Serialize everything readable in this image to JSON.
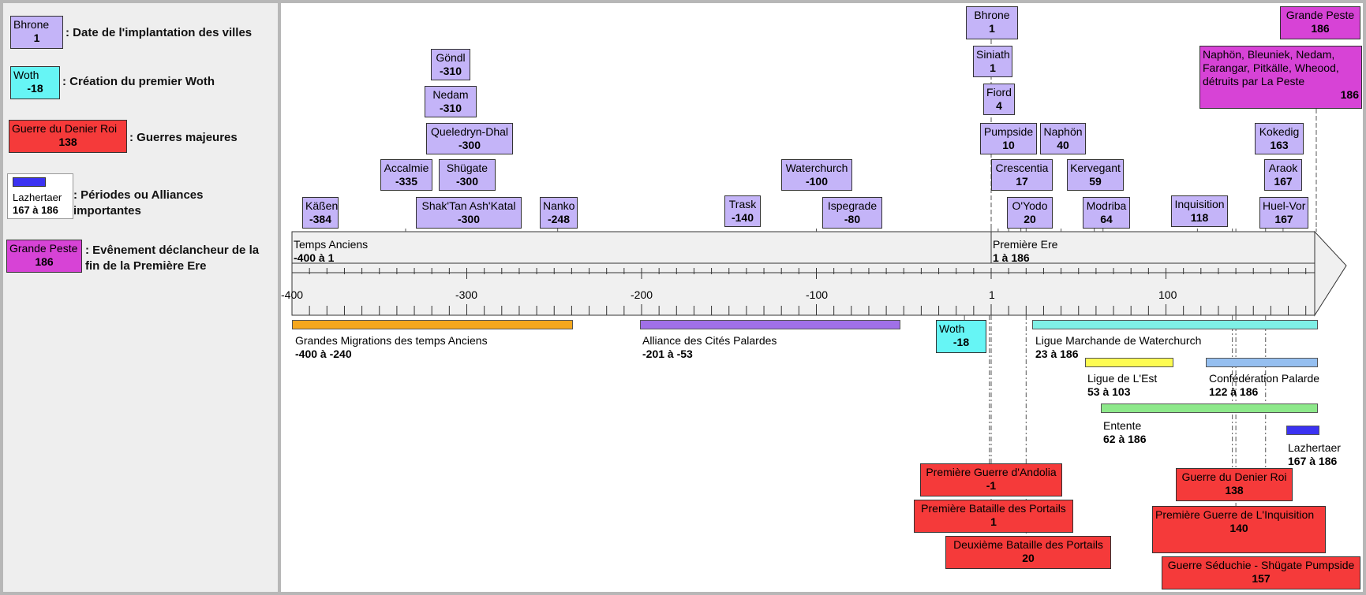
{
  "legend": {
    "items": [
      {
        "box": {
          "name": "Bhrone",
          "date": "1"
        },
        "text": ": Date de l'implantation des villes"
      },
      {
        "box": {
          "name": "Woth",
          "date": "-18"
        },
        "text": ": Création du premier Woth"
      },
      {
        "box": {
          "name": "Guerre du Denier Roi",
          "date": "138"
        },
        "text": ": Guerres majeures"
      },
      {
        "box": {
          "name": "Lazhertaer",
          "date": "167 à 186"
        },
        "text": ": Périodes ou Alliances importantes"
      },
      {
        "box": {
          "name": "Grande Peste",
          "date": "186"
        },
        "text": ": Evênement déclancheur de la fin de la Première Ere"
      }
    ]
  },
  "colors": {
    "city": "#c4b4f8",
    "woth": "#66f5f5",
    "war": "#f53a3a",
    "plague": "#d743d6",
    "period": "#3b32f2"
  },
  "axis": {
    "ticks": [
      {
        "label": "-400",
        "value": -400
      },
      {
        "label": "-300",
        "value": -300
      },
      {
        "label": "-200",
        "value": -200
      },
      {
        "label": "-100",
        "value": -100
      },
      {
        "label": "1",
        "value": 0
      },
      {
        "label": "100",
        "value": 100
      }
    ],
    "eras": [
      {
        "name": "Temps Anciens",
        "range": "-400 à 1"
      },
      {
        "name": "Première Ere",
        "range": "1 à 186"
      }
    ]
  },
  "cities": [
    {
      "name": "Käßen",
      "date": "-384"
    },
    {
      "name": "Accalmie",
      "date": "-335"
    },
    {
      "name": "Göndl",
      "date": "-310"
    },
    {
      "name": "Nedam",
      "date": "-310"
    },
    {
      "name": "Queledryn-Dhal",
      "date": "-300"
    },
    {
      "name": "Shügate",
      "date": "-300"
    },
    {
      "name": "Shak'Tan Ash'Katal",
      "date": "-300"
    },
    {
      "name": "Nanko",
      "date": "-248"
    },
    {
      "name": "Trask",
      "date": "-140"
    },
    {
      "name": "Waterchurch",
      "date": "-100"
    },
    {
      "name": "Ispegrade",
      "date": "-80"
    },
    {
      "name": "Bhrone",
      "date": "1"
    },
    {
      "name": "Siniath",
      "date": "1"
    },
    {
      "name": "Fiord",
      "date": "4"
    },
    {
      "name": "Pumpside",
      "date": "10"
    },
    {
      "name": "Naphön",
      "date": "40"
    },
    {
      "name": "Crescentia",
      "date": "17"
    },
    {
      "name": "Kervegant",
      "date": "59"
    },
    {
      "name": "O'Yodo",
      "date": "20"
    },
    {
      "name": "Modriba",
      "date": "64"
    },
    {
      "name": "Inquisition",
      "date": "118"
    },
    {
      "name": "Kokedig",
      "date": "163"
    },
    {
      "name": "Araok",
      "date": "167"
    },
    {
      "name": "Huel-Vor",
      "date": "167"
    }
  ],
  "plague": [
    {
      "name": "Grande Peste",
      "date": "186"
    },
    {
      "name": "Naphön, Bleuniek, Nedam, Farangar, Pitkälle, Wheood, détruits par La Peste",
      "date": "186"
    }
  ],
  "woth": {
    "name": "Woth",
    "date": "-18"
  },
  "periods": [
    {
      "name": "Grandes Migrations des temps Anciens",
      "range": "-400 à -240",
      "color": "#f5a71e"
    },
    {
      "name": "Alliance des Cités Palardes",
      "range": "-201 à -53",
      "color": "#a070e8"
    },
    {
      "name": "Ligue Marchande de Waterchurch",
      "range": "23 à 186",
      "color": "#7ff0e6"
    },
    {
      "name": "Ligue de L'Est",
      "range": "53 à 103",
      "color": "#fdfc52"
    },
    {
      "name": "Confédération Palarde",
      "range": "122 à 186",
      "color": "#95bff0"
    },
    {
      "name": "Entente",
      "range": "62 à 186",
      "color": "#8de88a"
    },
    {
      "name": "Lazhertaer",
      "range": "167 à 186",
      "color": "#3b32f2"
    }
  ],
  "wars": [
    {
      "name": "Première Guerre d'Andolia",
      "date": "-1"
    },
    {
      "name": "Première Bataille des Portails",
      "date": "1"
    },
    {
      "name": "Deuxième Bataille des Portails",
      "date": "20"
    },
    {
      "name": "Guerre du Denier Roi",
      "date": "138"
    },
    {
      "name": "Première Guerre de L'Inquisition",
      "date": "140"
    },
    {
      "name": "Guerre Séduchie - Shügate Pumpside",
      "date": "157"
    }
  ]
}
